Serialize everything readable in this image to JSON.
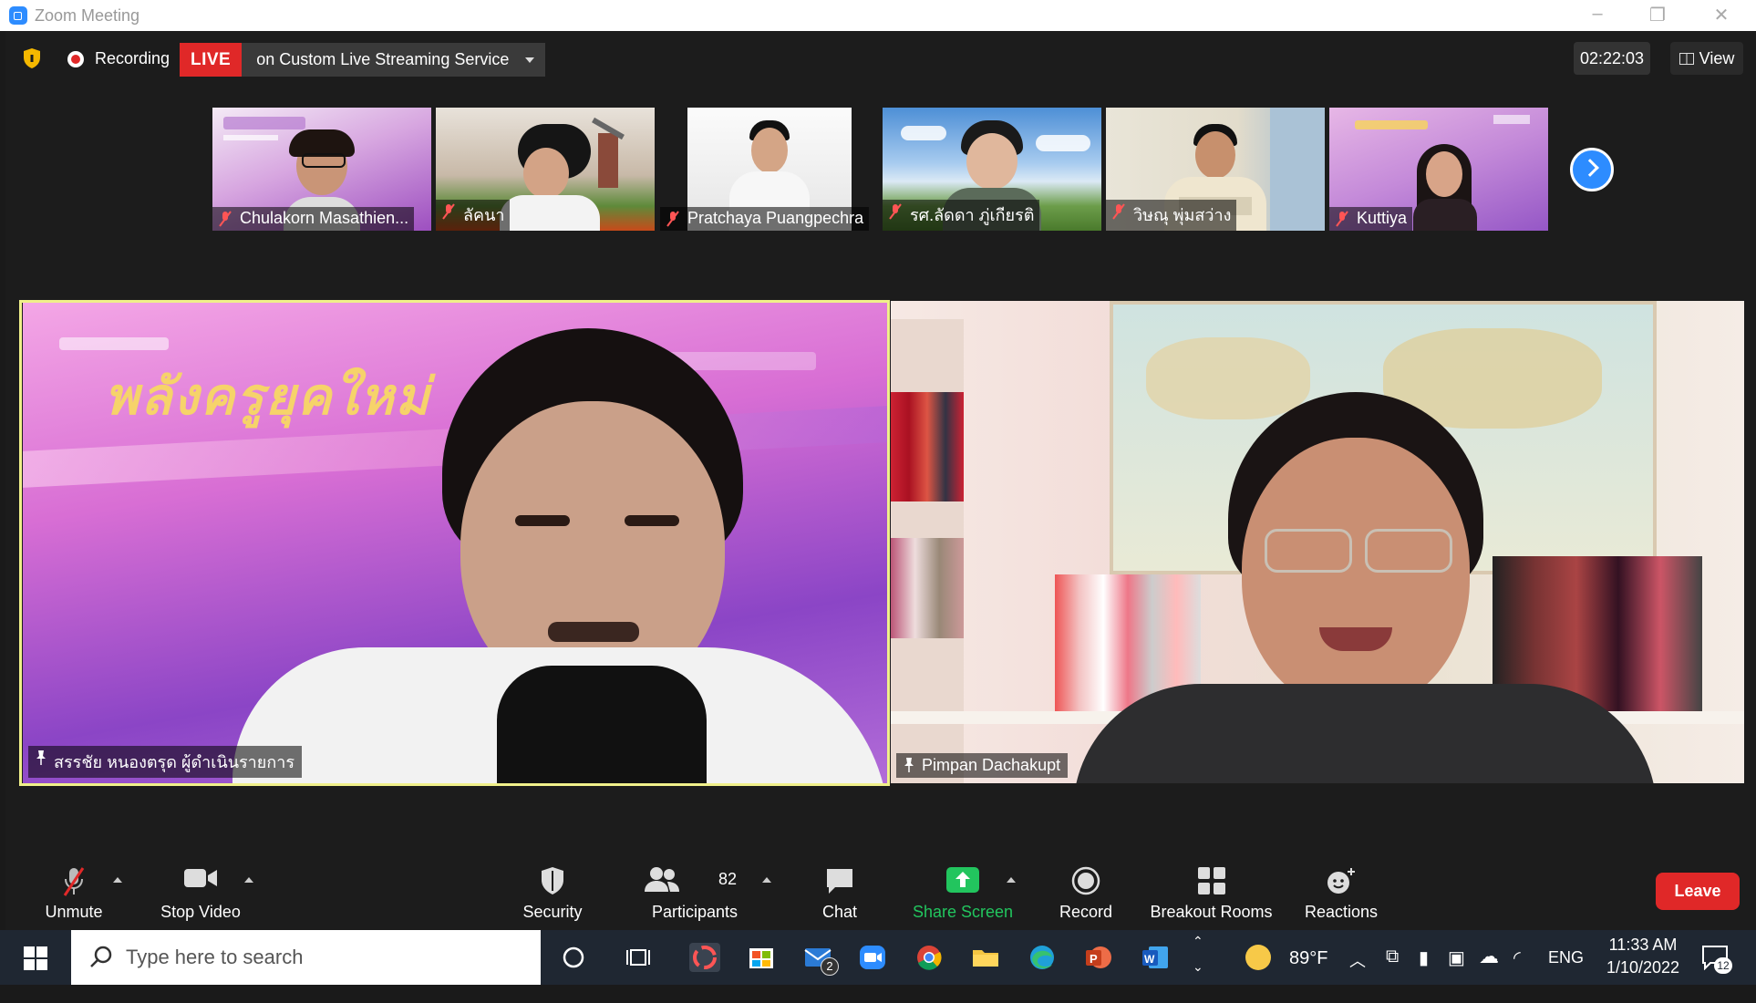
{
  "window": {
    "title": "Zoom Meeting"
  },
  "topbar": {
    "recording_label": "Recording",
    "live_label": "LIVE",
    "live_service": "on Custom Live Streaming Service",
    "timer": "02:22:03",
    "view_label": "View"
  },
  "thumbnails": [
    {
      "name": "Chulakorn Masathien..."
    },
    {
      "name": "ลัคนา"
    },
    {
      "name": "Pratchaya Puangpechra"
    },
    {
      "name": "รศ.ลัดดา ภู่เกียรติ"
    },
    {
      "name": "วิษณุ พุ่มสว่าง"
    },
    {
      "name": "Kuttiya"
    }
  ],
  "main_tiles": [
    {
      "name": "สรรชัย หนองตรุด ผู้ดำเนินรายการ",
      "banner_text": "พลังครูยุคใหม่"
    },
    {
      "name": "Pimpan Dachakupt"
    }
  ],
  "toolbar": {
    "unmute": "Unmute",
    "stop_video": "Stop Video",
    "security": "Security",
    "participants": "Participants",
    "participants_count": "82",
    "chat": "Chat",
    "share_screen": "Share Screen",
    "record": "Record",
    "breakout_rooms": "Breakout Rooms",
    "reactions": "Reactions",
    "leave": "Leave"
  },
  "colors": {
    "live_red": "#e02828",
    "share_green": "#22c55e",
    "zoom_blue": "#2d8cff",
    "speaker_border": "#f0f08a"
  },
  "taskbar": {
    "search_placeholder": "Type here to search",
    "mail_badge": "2",
    "weather": "89°F",
    "language": "ENG",
    "time": "11:33 AM",
    "date": "1/10/2022",
    "notification_count": "12"
  }
}
